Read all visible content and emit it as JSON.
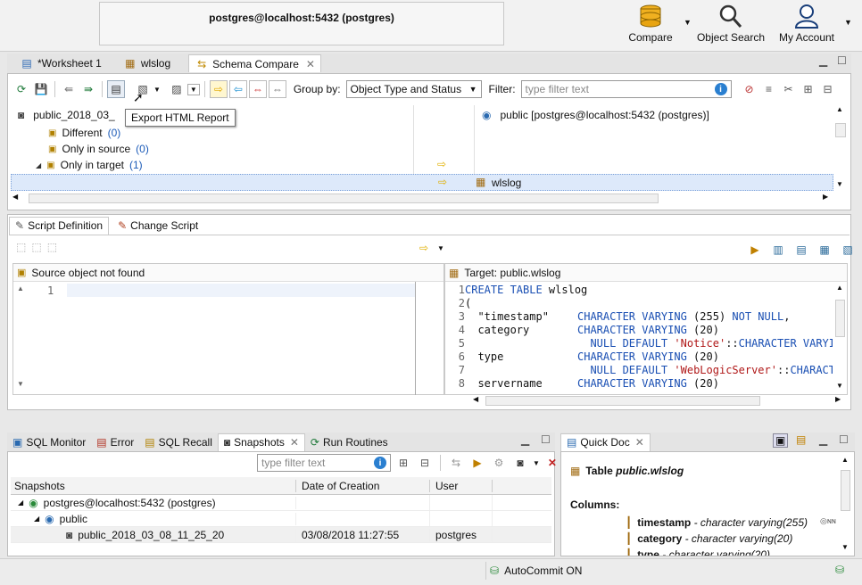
{
  "window": {
    "connection_title": "postgres@localhost:5432 (postgres)"
  },
  "top_toolbar": [
    {
      "label": "Compare",
      "icon": "database-stack-icon"
    },
    {
      "label": "Object Search",
      "icon": "magnifier-icon"
    },
    {
      "label": "My Account",
      "icon": "user-icon"
    }
  ],
  "editor_tabs": [
    {
      "label": "*Worksheet 1",
      "icon": "sql-worksheet-icon"
    },
    {
      "label": "wlslog",
      "icon": "table-icon"
    },
    {
      "label": "Schema Compare",
      "icon": "schema-compare-icon",
      "active": true
    }
  ],
  "compare_toolbar": {
    "group_by_label": "Group by:",
    "group_by_value": "Object Type and Status",
    "filter_label": "Filter:",
    "filter_placeholder": "type filter text",
    "tooltip": "Export HTML Report"
  },
  "compare_tree": {
    "source_root": "public_2018_03_08_11_25_20",
    "target_root": "public [postgres@localhost:5432 (postgres)]",
    "groups": [
      {
        "label": "Different",
        "count": "(0)"
      },
      {
        "label": "Only in source",
        "count": "(0)"
      },
      {
        "label": "Only in target",
        "count": "(1)"
      }
    ],
    "selected_target": "wlslog"
  },
  "script_tabs": [
    {
      "label": "Script Definition",
      "active": true
    },
    {
      "label": "Change Script"
    }
  ],
  "source_pane": {
    "title": "Source object not found",
    "lines": [
      "1"
    ]
  },
  "target_pane": {
    "title": "Target: public.wlslog",
    "lines": [
      {
        "n": "1",
        "a": "CREATE TABLE wlslog",
        "b": "",
        "c": ""
      },
      {
        "n": "2",
        "a": "(",
        "b": "",
        "c": ""
      },
      {
        "n": "3",
        "a": "  \"timestamp\"",
        "b": "CHARACTER VARYING (255) NOT NULL,",
        "c": ""
      },
      {
        "n": "4",
        "a": "  category",
        "b": "CHARACTER VARYING (20)",
        "c": ""
      },
      {
        "n": "5",
        "a": "",
        "b": "  NULL DEFAULT 'Notice'::CHARACTER VARYI",
        "c": ""
      },
      {
        "n": "6",
        "a": "  type",
        "b": "CHARACTER VARYING (20)",
        "c": ""
      },
      {
        "n": "7",
        "a": "",
        "b": "  NULL DEFAULT 'WebLogicServer'::CHARACT",
        "c": ""
      },
      {
        "n": "8",
        "a": "  servername",
        "b": "CHARACTER VARYING (20)",
        "c": ""
      }
    ]
  },
  "bottom_tabs": [
    {
      "label": "SQL Monitor",
      "icon": "monitor-icon"
    },
    {
      "label": "Error",
      "icon": "error-icon"
    },
    {
      "label": "SQL Recall",
      "icon": "recall-icon"
    },
    {
      "label": "Snapshots",
      "icon": "camera-icon",
      "active": true
    },
    {
      "label": "Run Routines",
      "icon": "routine-icon"
    }
  ],
  "snapshots": {
    "filter_placeholder": "type filter text",
    "columns": [
      "Snapshots",
      "Date of Creation",
      "User"
    ],
    "rows": [
      {
        "name": "postgres@localhost:5432 (postgres)",
        "date": "",
        "user": ""
      },
      {
        "name": "public",
        "date": "",
        "user": ""
      },
      {
        "name": "public_2018_03_08_11_25_20",
        "date": "03/08/2018 11:27:55",
        "user": "postgres"
      }
    ]
  },
  "quick_doc": {
    "tab_label": "Quick Doc",
    "table_prefix": "Table ",
    "table_name": "public.wlslog",
    "columns_label": "Columns:",
    "columns": [
      {
        "name": "timestamp",
        "type": " - character varying(255)"
      },
      {
        "name": "category",
        "type": " - character varying(20)"
      },
      {
        "name": "type",
        "type": " - character varying(20)"
      }
    ]
  },
  "status_bar": {
    "autocommit": "AutoCommit ON"
  },
  "colors": {
    "selection": "#dde9fa",
    "accent": "#1c5bb8",
    "arrow": "#f4c400",
    "keyword": "#1a4fb3",
    "string": "#b01818"
  }
}
